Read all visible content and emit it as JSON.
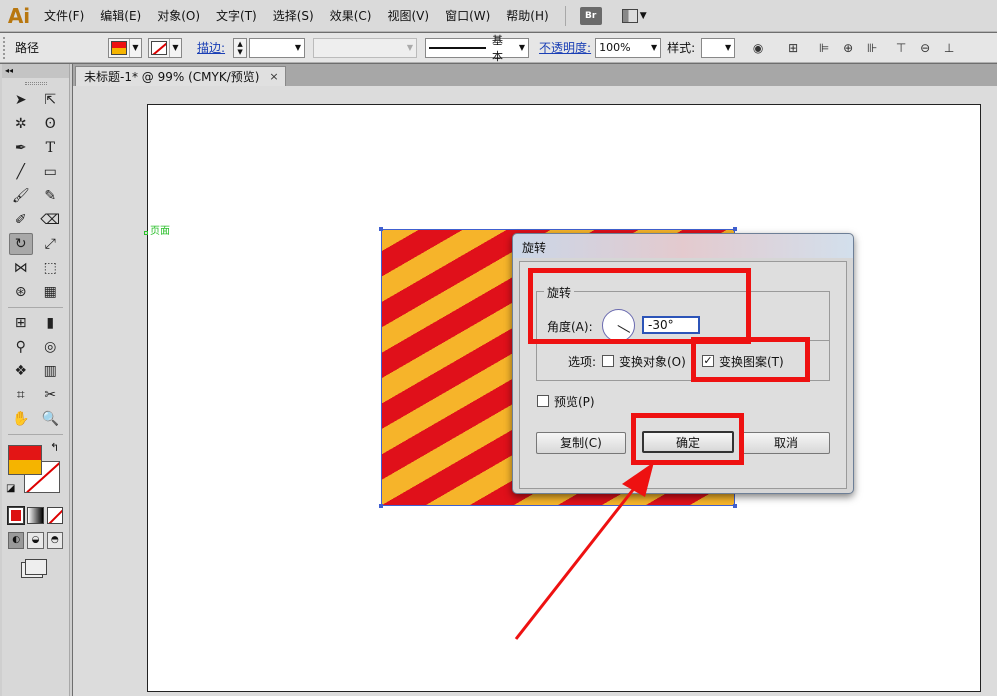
{
  "app": {
    "logo": "Ai"
  },
  "menu": [
    "文件(F)",
    "编辑(E)",
    "对象(O)",
    "文字(T)",
    "选择(S)",
    "效果(C)",
    "视图(V)",
    "窗口(W)",
    "帮助(H)"
  ],
  "menu_badge": "Br",
  "control_bar": {
    "object_type": "路径",
    "stroke_label": "描边:",
    "stroke_style": "基本",
    "opacity_label": "不透明度:",
    "opacity_value": "100%",
    "style_label": "样式:"
  },
  "document_tab": {
    "title": "未标题-1* @ 99% (CMYK/预览)",
    "close": "×"
  },
  "canvas": {
    "page_label": "页面"
  },
  "colors": {
    "stripe_red": "#e0101a",
    "stripe_yellow": "#f6b42a",
    "highlight": "#ee1111"
  },
  "dialog": {
    "title": "旋转",
    "group_title": "旋转",
    "angle_label": "角度(A):",
    "angle_value": "-30°",
    "options_label": "选项:",
    "transform_objects": {
      "label": "变换对象(O)",
      "checked": false
    },
    "transform_patterns": {
      "label": "变换图案(T)",
      "checked": true
    },
    "preview": {
      "label": "预览(P)",
      "checked": false
    },
    "buttons": {
      "copy": "复制(C)",
      "ok": "确定",
      "cancel": "取消"
    }
  }
}
